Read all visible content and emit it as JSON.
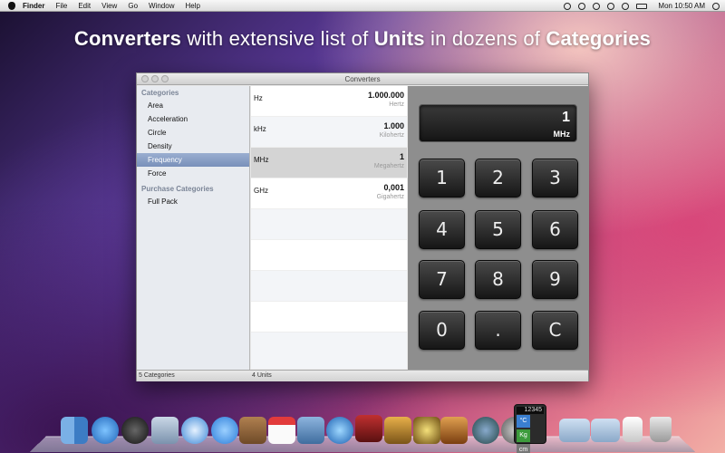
{
  "menubar": {
    "app": "Finder",
    "items": [
      "File",
      "Edit",
      "View",
      "Go",
      "Window",
      "Help"
    ],
    "clock": "Mon 10:50 AM"
  },
  "headline": {
    "w1": "Converters",
    "w2": " with extensive list of ",
    "w3": "Units",
    "w4": " in dozens of ",
    "w5": "Categories"
  },
  "window": {
    "title": "Converters",
    "sidebar": {
      "header1": "Categories",
      "categories": [
        "Area",
        "Acceleration",
        "Circle",
        "Density",
        "Frequency",
        "Force"
      ],
      "header2": "Purchase Categories",
      "purchase": [
        "Full Pack"
      ]
    },
    "units": [
      {
        "name": "Hz",
        "value": "1.000.000",
        "full": "Hertz"
      },
      {
        "name": "kHz",
        "value": "1.000",
        "full": "Kilohertz"
      },
      {
        "name": "MHz",
        "value": "1",
        "full": "Megahertz"
      },
      {
        "name": "GHz",
        "value": "0,001",
        "full": "Gigahertz"
      }
    ],
    "display": {
      "value": "1",
      "unit": "MHz"
    },
    "keys": [
      "1",
      "2",
      "3",
      "4",
      "5",
      "6",
      "7",
      "8",
      "9",
      "0",
      ".",
      "C"
    ],
    "footer": {
      "left": "5 Categories",
      "mid": "4 Units"
    }
  },
  "colors": {
    "selection": "#8a9ec6",
    "keypad_bg": "#8e8e8e",
    "key": "#2a2a2a"
  },
  "dock": {
    "icons": [
      "finder-icon",
      "app-store-icon",
      "dashboard-icon",
      "mail-stamp-icon",
      "safari-icon",
      "ichat-icon",
      "address-book-icon",
      "ical-icon",
      "preview-icon",
      "itunes-icon",
      "photo-booth-icon",
      "iphoto-icon",
      "imovie-icon",
      "garageband-icon",
      "time-machine-icon",
      "system-preferences-icon",
      "converters-app-icon",
      "applications-folder-icon",
      "documents-folder-icon",
      "downloads-stack-icon",
      "trash-icon"
    ],
    "converters_label": "12345",
    "converters_tiles": [
      "°C",
      "Kg",
      "cm",
      "="
    ]
  }
}
